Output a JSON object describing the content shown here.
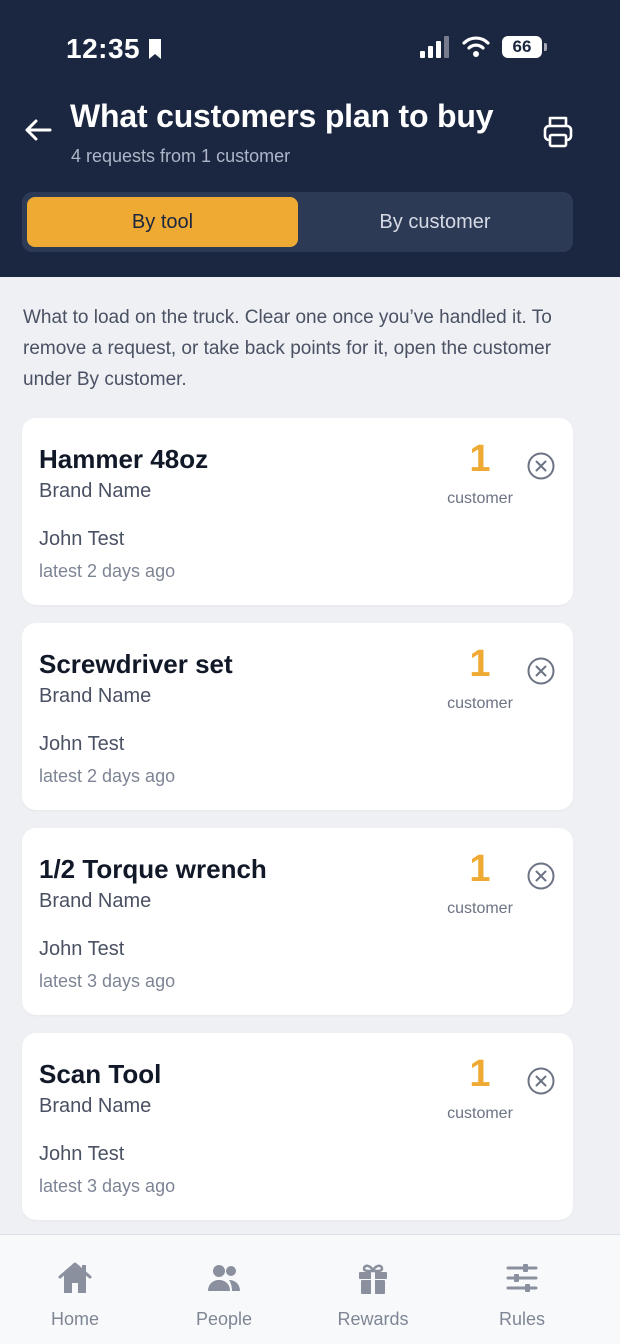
{
  "status_bar": {
    "time": "12:35",
    "battery": "66"
  },
  "header": {
    "title": "What customers plan to buy",
    "subtitle": "4 requests from 1 customer",
    "back_icon": "arrow-left-icon",
    "print_icon": "printer-icon"
  },
  "segment": {
    "active": "By tool",
    "inactive": "By customer"
  },
  "intro": "What to load on the truck. Clear one once you’ve handled it. To remove a request, or take back points for it, open the customer under By customer.",
  "items": [
    {
      "tool": "Hammer 48oz",
      "brand": "Brand Name",
      "customer": "John Test",
      "when": "latest 2 days ago",
      "count": "1",
      "count_label": "customer"
    },
    {
      "tool": "Screwdriver set",
      "brand": "Brand Name",
      "customer": "John Test",
      "when": "latest 2 days ago",
      "count": "1",
      "count_label": "customer"
    },
    {
      "tool": "1/2 Torque wrench",
      "brand": "Brand Name",
      "customer": "John Test",
      "when": "latest 3 days ago",
      "count": "1",
      "count_label": "customer"
    },
    {
      "tool": "Scan Tool",
      "brand": "Brand Name",
      "customer": "John Test",
      "when": "latest 3 days ago",
      "count": "1",
      "count_label": "customer"
    }
  ],
  "tabbar": [
    {
      "label": "Home",
      "icon": "home-icon"
    },
    {
      "label": "People",
      "icon": "people-icon"
    },
    {
      "label": "Rewards",
      "icon": "gift-icon"
    },
    {
      "label": "Rules",
      "icon": "sliders-icon"
    }
  ],
  "colors": {
    "header_bg": "#1b2640",
    "accent": "#efaa33",
    "page_bg": "#eef0f4"
  }
}
